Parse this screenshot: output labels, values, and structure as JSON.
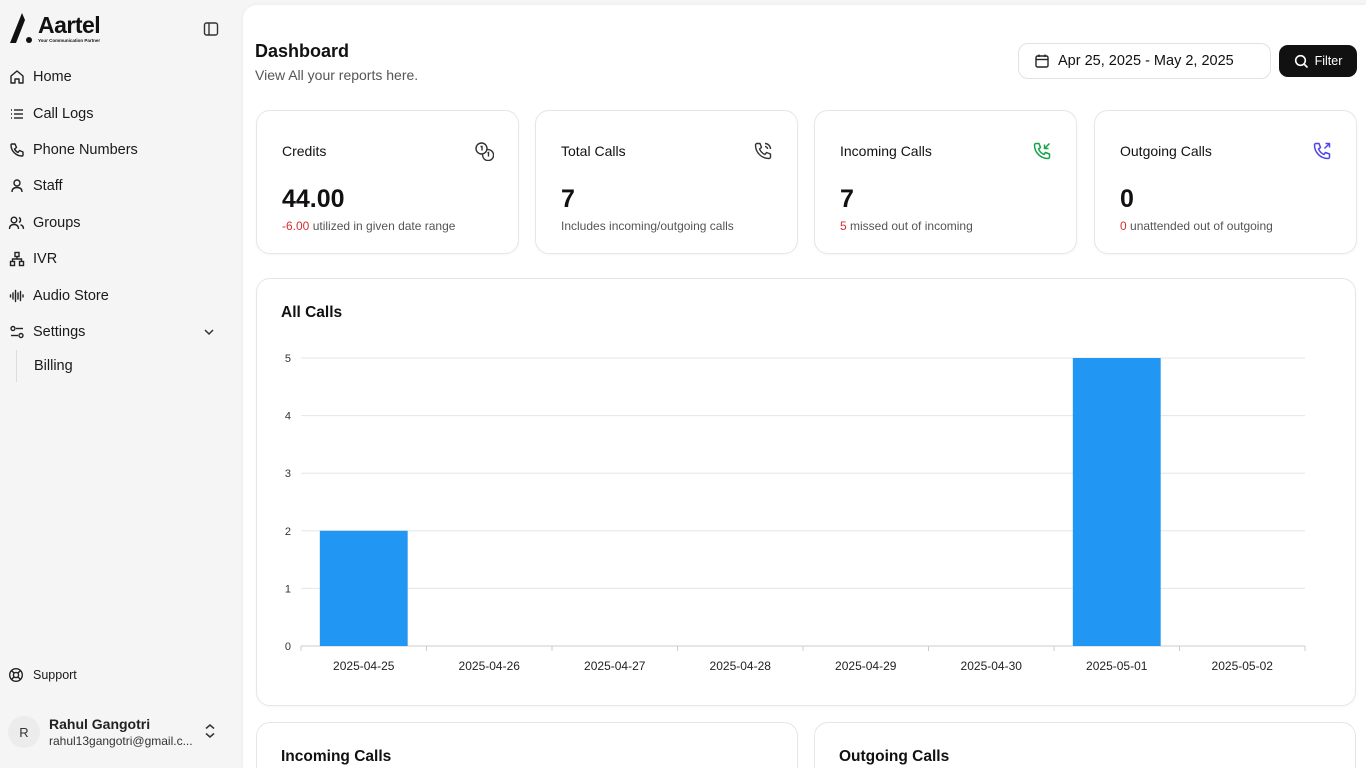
{
  "brand": {
    "name": "Aartel",
    "tagline": "Your Communication Partner"
  },
  "sidebar": {
    "items": [
      {
        "label": "Home",
        "icon": "home-icon"
      },
      {
        "label": "Call Logs",
        "icon": "list-icon"
      },
      {
        "label": "Phone Numbers",
        "icon": "phone-icon"
      },
      {
        "label": "Staff",
        "icon": "user-icon"
      },
      {
        "label": "Groups",
        "icon": "users-icon"
      },
      {
        "label": "IVR",
        "icon": "network-icon"
      },
      {
        "label": "Audio Store",
        "icon": "audio-wave-icon"
      },
      {
        "label": "Settings",
        "icon": "settings-sliders-icon"
      }
    ],
    "sub_items": [
      {
        "label": "Billing"
      }
    ],
    "support": "Support",
    "user": {
      "initial": "R",
      "name": "Rahul Gangotri",
      "email": "rahul13gangotri@gmail.c..."
    }
  },
  "header": {
    "title": "Dashboard",
    "subtitle": "View All your reports here.",
    "date_range": "Apr 25, 2025 - May 2, 2025",
    "filter_label": "Filter"
  },
  "cards": [
    {
      "title": "Credits",
      "value": "44.00",
      "highlight": "-6.00",
      "desc": " utilized in given date range",
      "icon": "coins-icon"
    },
    {
      "title": "Total Calls",
      "value": "7",
      "highlight": "",
      "desc": "Includes incoming/outgoing calls",
      "icon": "phone-call-icon"
    },
    {
      "title": "Incoming Calls",
      "value": "7",
      "highlight": "5",
      "desc": " missed out of incoming",
      "icon": "phone-incoming-icon"
    },
    {
      "title": "Outgoing Calls",
      "value": "0",
      "highlight": "0",
      "desc": " unattended out of outgoing",
      "icon": "phone-outgoing-icon"
    }
  ],
  "colors": {
    "accent_bar": "#2196f3",
    "incoming_icon": "#16a34a",
    "outgoing_icon": "#4f46e5",
    "negative": "#d32f2f"
  },
  "chart_data": {
    "type": "bar",
    "title": "All Calls",
    "categories": [
      "2025-04-25",
      "2025-04-26",
      "2025-04-27",
      "2025-04-28",
      "2025-04-29",
      "2025-04-30",
      "2025-05-01",
      "2025-05-02"
    ],
    "values": [
      2,
      0,
      0,
      0,
      0,
      0,
      5,
      0
    ],
    "yticks": [
      0,
      1,
      2,
      3,
      4,
      5
    ],
    "ylim": [
      0,
      5
    ],
    "grid": true
  },
  "bottom": {
    "incoming_title": "Incoming Calls",
    "outgoing_title": "Outgoing Calls"
  }
}
